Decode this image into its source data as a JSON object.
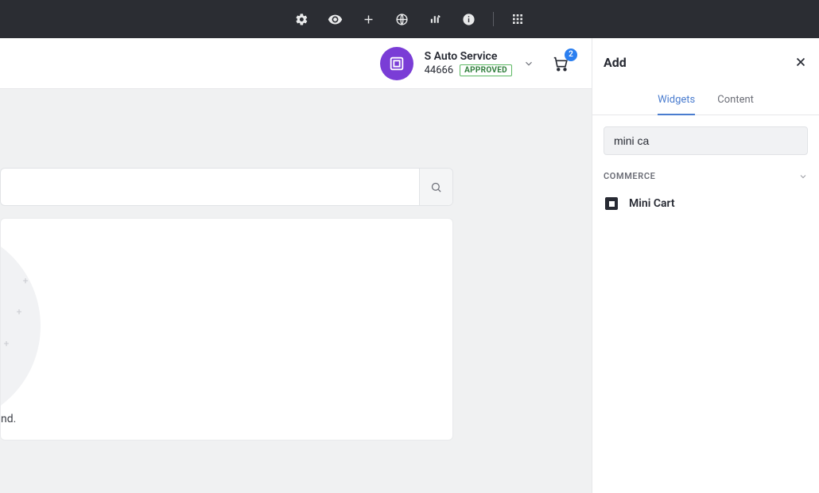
{
  "header": {
    "account_name": "S Auto Service",
    "account_id": "44666",
    "status_badge": "APPROVED",
    "cart_count": "2"
  },
  "canvas": {
    "body_text": "nd."
  },
  "sidebar": {
    "title": "Add",
    "tabs": {
      "widgets": "Widgets",
      "content": "Content"
    },
    "search_value": "mini ca",
    "categories": {
      "commerce": {
        "label": "COMMERCE",
        "items": {
          "mini_cart": "Mini Cart"
        }
      }
    }
  }
}
